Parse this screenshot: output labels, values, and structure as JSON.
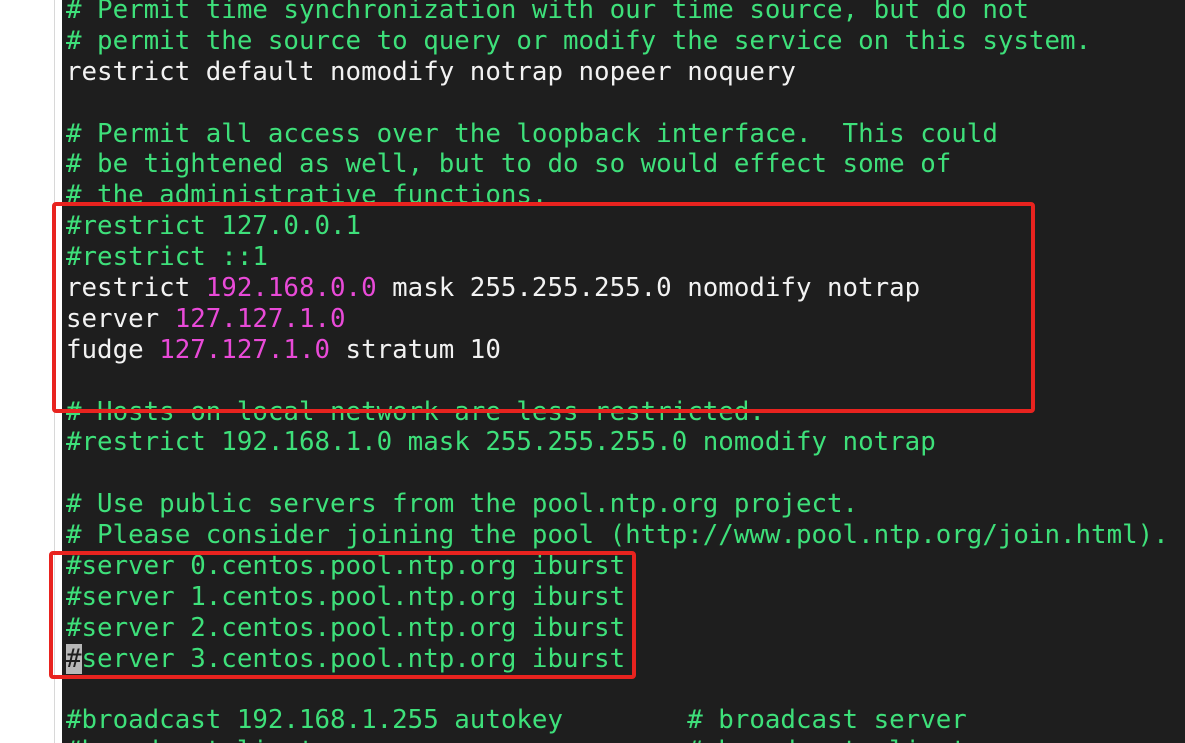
{
  "editor": {
    "lines": [
      {
        "text": "# Permit time synchronization with our time source, but do not",
        "kind": "comment"
      },
      {
        "text": "# permit the source to query or modify the service on this system.",
        "kind": "comment"
      },
      {
        "text": "restrict default nomodify notrap nopeer noquery",
        "kind": "text"
      },
      {
        "text": "",
        "kind": "blank"
      },
      {
        "text": "# Permit all access over the loopback interface.  This could",
        "kind": "comment"
      },
      {
        "text": "# be tightened as well, but to do so would effect some of",
        "kind": "comment"
      },
      {
        "text": "# the administrative functions.",
        "kind": "comment"
      },
      {
        "text": "#restrict 127.0.0.1",
        "kind": "comment"
      },
      {
        "text": "#restrict ::1",
        "kind": "comment"
      },
      {
        "kind": "mixed",
        "parts": [
          {
            "text": "restrict ",
            "kind": "text"
          },
          {
            "text": "192.168.0.0",
            "kind": "ip"
          },
          {
            "text": " mask 255.255.255.0 nomodify notrap",
            "kind": "text"
          }
        ]
      },
      {
        "kind": "mixed",
        "parts": [
          {
            "text": "server ",
            "kind": "text"
          },
          {
            "text": "127.127.1.0",
            "kind": "ip"
          }
        ]
      },
      {
        "kind": "mixed",
        "parts": [
          {
            "text": "fudge ",
            "kind": "text"
          },
          {
            "text": "127.127.1.0",
            "kind": "ip"
          },
          {
            "text": " stratum 10",
            "kind": "text"
          }
        ]
      },
      {
        "text": "",
        "kind": "blank"
      },
      {
        "text": "# Hosts on local network are less restricted.",
        "kind": "comment"
      },
      {
        "text": "#restrict 192.168.1.0 mask 255.255.255.0 nomodify notrap",
        "kind": "comment"
      },
      {
        "text": "",
        "kind": "blank"
      },
      {
        "text": "# Use public servers from the pool.ntp.org project.",
        "kind": "comment"
      },
      {
        "text": "# Please consider joining the pool (http://www.pool.ntp.org/join.html).",
        "kind": "comment"
      },
      {
        "text": "#server 0.centos.pool.ntp.org iburst",
        "kind": "comment"
      },
      {
        "text": "#server 1.centos.pool.ntp.org iburst",
        "kind": "comment"
      },
      {
        "text": "#server 2.centos.pool.ntp.org iburst",
        "kind": "comment"
      },
      {
        "kind": "cursorline",
        "parts": [
          {
            "text": "#",
            "kind": "cursor"
          },
          {
            "text": "server 3.centos.pool.ntp.org iburst",
            "kind": "comment"
          }
        ]
      },
      {
        "text": "",
        "kind": "blank"
      },
      {
        "text": "#broadcast 192.168.1.255 autokey        # broadcast server",
        "kind": "comment"
      },
      {
        "text": "#broadcastclient                        # broadcast client",
        "kind": "comment"
      }
    ]
  },
  "colors": {
    "comment": "#3ee07a",
    "text": "#f2f2f2",
    "ip": "#e94ad8",
    "highlight_box": "#e8231f",
    "background": "#1e1e1e"
  }
}
